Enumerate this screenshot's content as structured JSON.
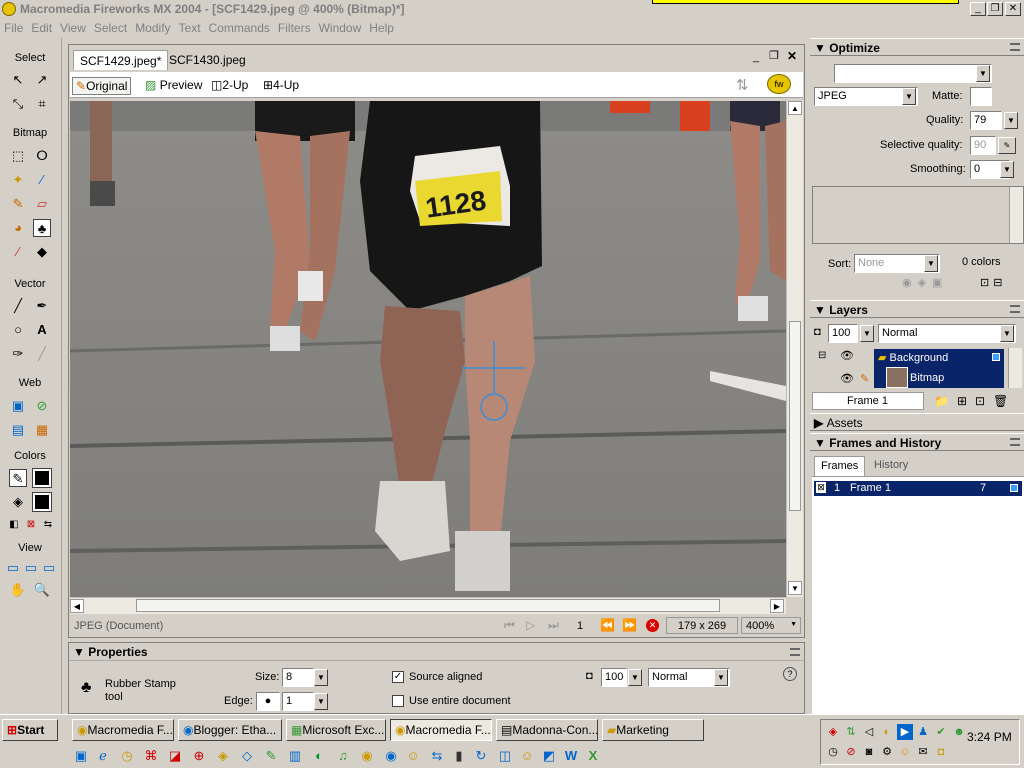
{
  "window": {
    "title": "Macromedia Fireworks MX 2004 - [SCF1429.jpeg @ 400% (Bitmap)*]"
  },
  "menu": [
    "File",
    "Edit",
    "View",
    "Select",
    "Modify",
    "Text",
    "Commands",
    "Filters",
    "Window",
    "Help"
  ],
  "tools": {
    "sections": [
      "Select",
      "Bitmap",
      "Vector",
      "Web",
      "Colors",
      "View"
    ]
  },
  "document": {
    "tabs": [
      "SCF1429.jpeg*",
      "SCF1430.jpeg"
    ],
    "views": [
      "Original",
      "Preview",
      "2-Up",
      "4-Up"
    ],
    "status_left": "JPEG (Document)",
    "frame_num": "1",
    "dimensions": "179 x 269",
    "zoom": "400%",
    "bib_number": "1128"
  },
  "properties": {
    "title": "Properties",
    "tool_name": "Rubber Stamp tool",
    "size_label": "Size:",
    "size_value": "8",
    "edge_label": "Edge:",
    "edge_value": "1",
    "source_aligned": "Source aligned",
    "use_entire": "Use entire document",
    "opacity": "100",
    "blend": "Normal"
  },
  "optimize": {
    "title": "Optimize",
    "format": "JPEG",
    "matte_label": "Matte:",
    "quality_label": "Quality:",
    "quality_value": "79",
    "selq_label": "Selective quality:",
    "selq_value": "90",
    "smoothing_label": "Smoothing:",
    "smoothing_value": "0",
    "sort_label": "Sort:",
    "sort_value": "None",
    "colors_count": "0 colors"
  },
  "layers": {
    "title": "Layers",
    "opacity": "100",
    "blend": "Normal",
    "layer_name": "Background",
    "object_name": "Bitmap",
    "frame": "Frame 1"
  },
  "assets": {
    "title": "Assets"
  },
  "frames": {
    "title": "Frames and History",
    "tab_frames": "Frames",
    "tab_history": "History",
    "frame_num": "1",
    "frame_name": "Frame 1",
    "frame_delay": "7"
  },
  "taskbar": {
    "start": "Start",
    "tasks": [
      "Macromedia F...",
      "Blogger: Etha...",
      "Microsoft Exc...",
      "Macromedia F...",
      "Madonna-Con...",
      "Marketing"
    ],
    "clock": "3:24 PM"
  }
}
